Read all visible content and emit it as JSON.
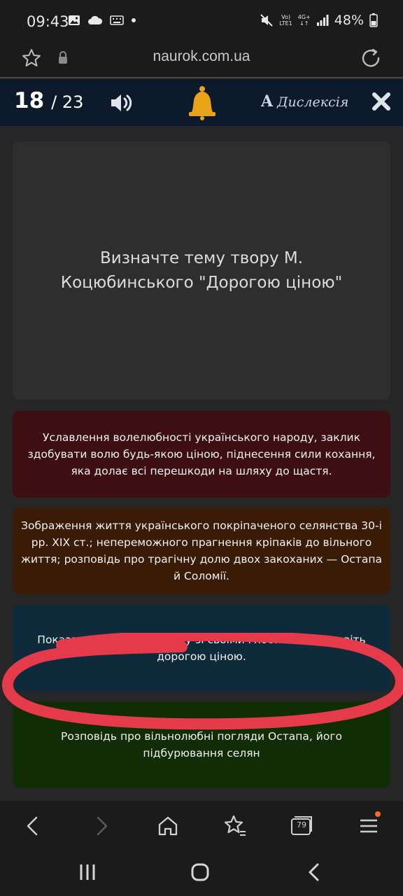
{
  "status_bar": {
    "time": "09:43",
    "network_top": "Vo)",
    "network_bottom": "LTE1",
    "signal_type": "4G+",
    "battery": "48%",
    "icons": [
      "image-icon",
      "cloud-icon",
      "keyboard-icon",
      "dot-icon",
      "mute-icon",
      "signal-icon",
      "battery-icon"
    ]
  },
  "browser": {
    "url": "naurok.com.ua",
    "tabs_count": "79"
  },
  "quiz": {
    "current": "18",
    "separator_total": "/ 23",
    "dyslexia_icon": "A",
    "dyslexia_label": "Дислексія",
    "bell_color": "#e8a317"
  },
  "question": {
    "text": "Визначте тему твору М. Коцюбинського \"Дорогою ціною\""
  },
  "answers": [
    {
      "text": "Уславлення волелюбності українського народу, заклик здобувати волю будь-якою ціною, піднесення сили кохання, яка долає всі перешкоди на шляху до щастя.",
      "color": "#3d0f12"
    },
    {
      "text": "Зображення життя українського покріпаченого селянства 30-і рр. XIX ст.; непереможного прагнення кріпаків до вільного життя; розповідь про трагічну долю двох закоханих — Остапа й Соломії.",
      "color": "#3a1c06"
    },
    {
      "text": "Показати боротьбу народу зі своїми гнобителями, навіть дорогою ціною.",
      "color": "#0f2b3b"
    },
    {
      "text": "Розповідь про вільнолюбні погляди Остапа, його підбурювання селян",
      "color": "#112d06"
    }
  ],
  "annotation_color": "#e43a4a"
}
